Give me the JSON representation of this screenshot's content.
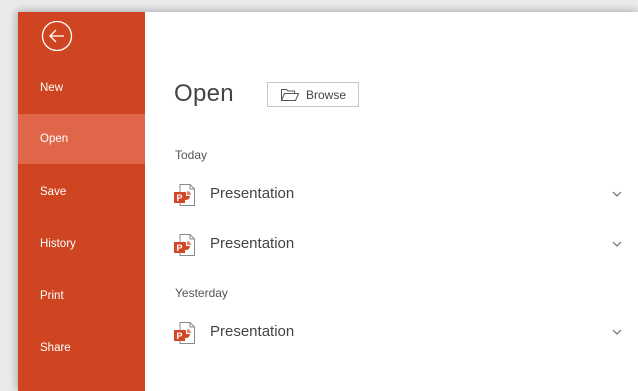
{
  "sidebar": {
    "back_icon": "back-arrow-icon",
    "items": [
      {
        "label": "New"
      },
      {
        "label": "Open",
        "active": true
      },
      {
        "label": "Save"
      },
      {
        "label": "History"
      },
      {
        "label": "Print"
      },
      {
        "label": "Share"
      }
    ]
  },
  "main": {
    "title": "Open",
    "browse_label": "Browse",
    "browse_icon": "folder-open-icon",
    "groups": [
      {
        "label": "Today",
        "files": [
          {
            "name": "Presentation"
          },
          {
            "name": "Presentation"
          }
        ]
      },
      {
        "label": "Yesterday",
        "files": [
          {
            "name": "Presentation"
          }
        ]
      }
    ],
    "file_icon": "powerpoint-file-icon",
    "expand_icon": "chevron-down-icon"
  },
  "colors": {
    "sidebar_bg": "#cf4521",
    "sidebar_active": "#e0664a",
    "text": "#444444",
    "file_icon_red": "#d24726"
  }
}
